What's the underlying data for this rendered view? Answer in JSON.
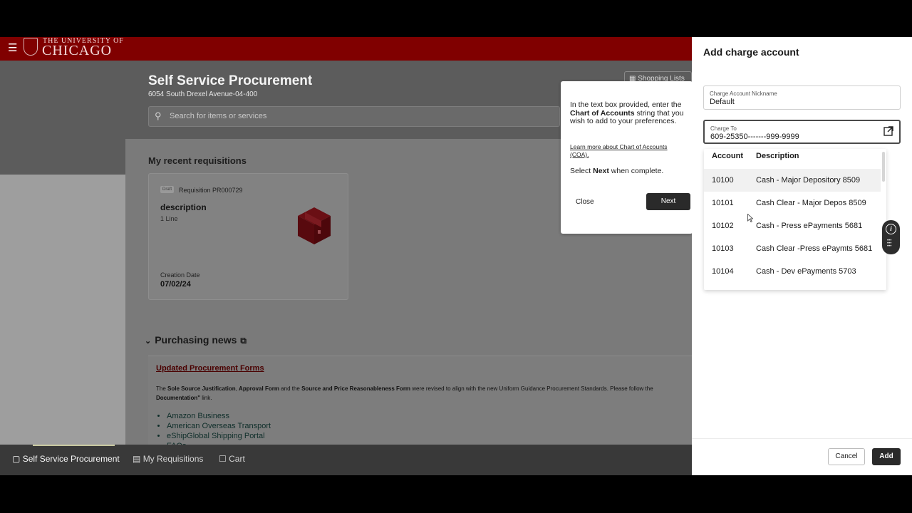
{
  "header": {
    "logo_top": "THE UNIVERSITY OF",
    "logo_main": "CHICAGO"
  },
  "hero": {
    "title": "Self Service Procurement",
    "address": "6054 South Drexel Avenue-04-400",
    "search_placeholder": "Search for items or services",
    "shopping_lists": "Shopping Lists"
  },
  "recent": {
    "title": "My recent requisitions",
    "card": {
      "badge": "Draft",
      "number": "Requisition PR000729",
      "description": "description",
      "lines": "1 Line",
      "creation_label": "Creation Date",
      "creation_date": "07/02/24"
    }
  },
  "news": {
    "title": "Purchasing news",
    "headline": "Updated Procurement Forms",
    "body_parts": [
      "The ",
      "Sole Source Justification",
      ", ",
      "Approval Form",
      " and the ",
      "Source and Price Reasonableness Form",
      " were revised to align with the new Uniform Guidance Procurement Standards. Please follow the",
      "Documentation\"",
      " link."
    ],
    "links": [
      "Amazon Business",
      "American Overseas Transport",
      "eShipGlobal Shipping Portal",
      "FAQs"
    ]
  },
  "bottom_nav": {
    "items": [
      "Self Service Procurement",
      "My Requisitions",
      "Cart"
    ]
  },
  "guide": {
    "text_pre": "In the text box provided, enter the ",
    "text_bold": "Chart of Accounts",
    "text_post": " string that you wish to add to your preferences.",
    "link": "Learn more about Chart of Accounts (COA).",
    "select_pre": "Select ",
    "select_bold": "Next",
    "select_post": " when complete.",
    "close": "Close",
    "next": "Next"
  },
  "drawer": {
    "title": "Add charge account",
    "nickname_label": "Charge Account Nickname",
    "nickname_value": "Default",
    "charge_to_label": "Charge To",
    "charge_to_value": "609-25350-------999-9999",
    "columns": [
      "Account",
      "Description"
    ],
    "rows": [
      {
        "account": "10100",
        "description": "Cash - Major Depository 8509"
      },
      {
        "account": "10101",
        "description": "Cash Clear - Major Depos 8509"
      },
      {
        "account": "10102",
        "description": "Cash - Press ePayments 5681"
      },
      {
        "account": "10103",
        "description": "Cash Clear -Press ePaymts 5681"
      },
      {
        "account": "10104",
        "description": "Cash - Dev ePayments 5703"
      }
    ],
    "cancel": "Cancel",
    "add": "Add"
  },
  "colors": {
    "brand": "#800000",
    "overlay": "#7a7a7a",
    "primary_button": "#2a2a2a"
  }
}
